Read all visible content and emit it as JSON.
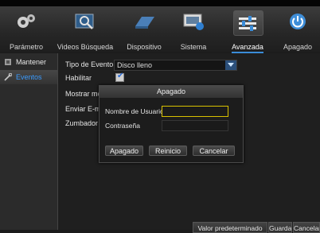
{
  "tabs": [
    {
      "label": "Parámetro",
      "icon": "gears-icon"
    },
    {
      "label": "Videos Búsqueda",
      "icon": "video-search-icon"
    },
    {
      "label": "Dispositivo",
      "icon": "hard-drive-icon"
    },
    {
      "label": "Sistema",
      "icon": "system-info-icon"
    },
    {
      "label": "Avanzada",
      "icon": "sliders-icon"
    },
    {
      "label": "Apagado",
      "icon": "power-icon"
    }
  ],
  "active_tab": "Avanzada",
  "sidebar": {
    "items": [
      {
        "label": "Mantener",
        "icon": "maintenance-icon"
      },
      {
        "label": "Eventos",
        "icon": "wrench-icon"
      }
    ],
    "active": "Eventos"
  },
  "form": {
    "event_type_label": "Tipo de Evento",
    "event_type_value": "Disco lleno",
    "enable_label": "Habilitar",
    "enable_checked": true,
    "show_msg_label": "Mostrar men",
    "send_email_label": "Enviar E-ma",
    "buzzer_label": "Zumbador"
  },
  "dialog": {
    "title": "Apagado",
    "username_label": "Nombre de Usuario",
    "username_value": "",
    "password_label": "Contraseña",
    "password_value": "",
    "buttons": [
      "Apagado",
      "Reinicio",
      "Cancelar"
    ]
  },
  "bottom_buttons": [
    "Valor predeterminado",
    "Guardar",
    "Cancelar"
  ],
  "colors": {
    "accent": "#3a8cd8",
    "focus_border": "#d8c000",
    "active_text": "#3b9cff"
  }
}
